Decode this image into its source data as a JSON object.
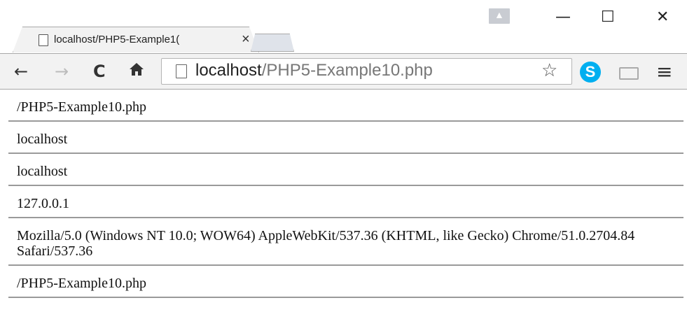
{
  "tab": {
    "title": "localhost/PHP5-Example1(",
    "close_label": "×"
  },
  "window_controls": {
    "minimize": "—",
    "maximize": "☐",
    "close": "✕"
  },
  "toolbar": {
    "back": "←",
    "forward": "→",
    "reload": "C",
    "home": "🏠",
    "url_host": "localhost",
    "url_path": "/PHP5-Example10.php",
    "star": "☆",
    "skype": "S",
    "menu": "≡"
  },
  "page": {
    "lines": [
      "/PHP5-Example10.php",
      "localhost",
      "localhost",
      "127.0.0.1",
      "Mozilla/5.0 (Windows NT 10.0; WOW64) AppleWebKit/537.36 (KHTML, like Gecko) Chrome/51.0.2704.84 Safari/537.36",
      "/PHP5-Example10.php"
    ]
  },
  "colors": {
    "toolbar_bg": "#f2f2f2",
    "skype_blue": "#00aff0"
  }
}
